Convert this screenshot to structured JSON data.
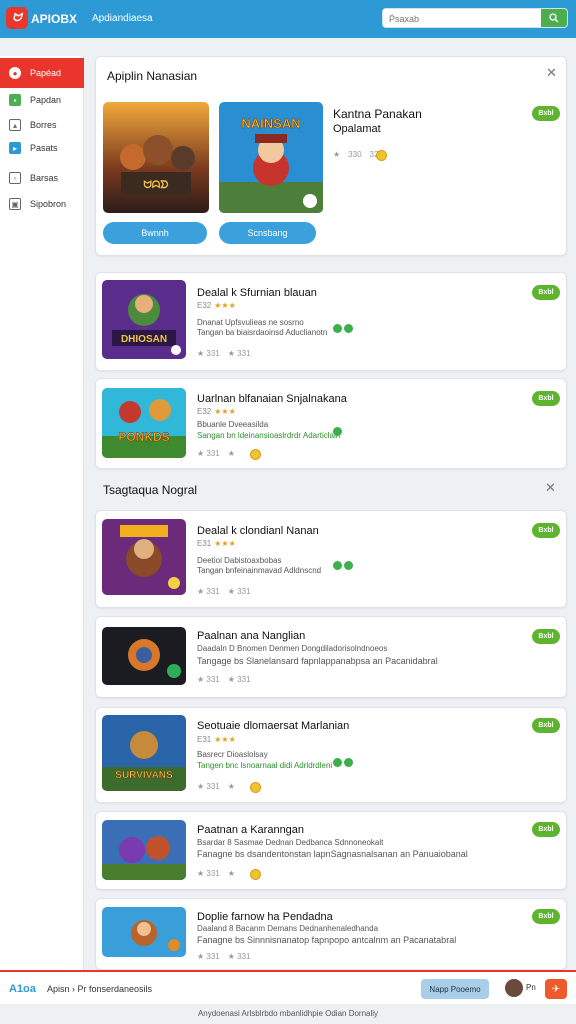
{
  "header": {
    "logo_text": "ᗢ",
    "brand": "APIOBX",
    "subtitle": "Apdiandiaesa",
    "search_placeholder": "Ṕsaxab"
  },
  "sidebar": {
    "items": [
      {
        "label": "Papéad",
        "icon": "game-icon",
        "active": true
      },
      {
        "label": "Papdan",
        "icon": "trend-icon"
      },
      {
        "label": "Borres",
        "icon": "chart-icon"
      },
      {
        "label": "Pasats",
        "icon": "share-icon"
      },
      {
        "label": "Barsas",
        "icon": "box-icon"
      },
      {
        "label": "Sipobron",
        "icon": "settings-icon"
      }
    ]
  },
  "featured": {
    "title": "Apiplin Nanasian",
    "game_title_line1": "Kantna Panakan",
    "game_title_line2": "Opalamat",
    "badge": "Bxbl",
    "rating": "330",
    "downloads": "320",
    "button1": "Bwnnh",
    "button2": "Scnsbang",
    "thumb2_text": "NAINSAN"
  },
  "list1": [
    {
      "title": "Dealal k Sfurnian blauan",
      "rating": "E32",
      "meta1": "Dnanat   Upfsvulieas ne sosrno",
      "meta2": "Tangan ba biaisrdaoinsd Aduclianotn",
      "count1": "331",
      "count2": "331",
      "badge": "Bxbl",
      "thumb_text": "DHIOSAN"
    },
    {
      "title": "Uarlnan blfanaian Snjalnakana",
      "rating": "E32",
      "meta1": "Bbuanle   Dveeasilda",
      "meta2": "Sangan bn ldeinansioaslrdrdr Adarticlaln",
      "count1": "331",
      "count2": "",
      "badge": "Bxbl",
      "thumb_text": "PONKDS"
    }
  ],
  "section2": {
    "title": "Tsagtaqua Nogral"
  },
  "list2": [
    {
      "title": "Dealal k clondianl Nanan",
      "rating": "E31",
      "meta1": "Deetioi   Dabistoaxbobas",
      "meta2": "Tangan bnfeinainmavad Adldnscnd",
      "count1": "331",
      "count2": "331",
      "badge": "Bxbl"
    },
    {
      "title": "Paalnan ana Nanglian",
      "rating": "",
      "meta1": "Daadaln D Bnomen Denmen Dongdiladorisolndnoeos",
      "meta2": "Tangage bs Slanelansard fapnlappanabpsa an Pacanidabral",
      "count1": "331",
      "count2": "331",
      "badge": "Bxbl"
    },
    {
      "title": "Seotuaie dlomaersat Marlanian",
      "rating": "E31",
      "meta1": "Basrecr   Dioaslolsay",
      "meta2": "Tangen bnc lsnoarnaal didi Adrldrdleni",
      "count1": "331",
      "count2": "",
      "badge": "Bxbl",
      "thumb_text": "SURVIVANS"
    },
    {
      "title": "Paatnan a Karanngan",
      "rating": "",
      "meta1": "Bsardar 8 Sasmae Dednan Dedbanca Sdnnoneokalt",
      "meta2": "Fanagne bs dsandentonstan lapnSagnasnalsanan an Panuaiobanal",
      "count1": "331",
      "count2": "",
      "badge": "Bxbl"
    },
    {
      "title": "Doplie farnow ha Pendadna",
      "rating": "",
      "meta1": "Daaland 8 Bacanm Demans Dednanhenaledhanda",
      "meta2": "Fanagne bs Sinnnisnanatop fapnpopo antcalnm an Pacanatabral",
      "count1": "331",
      "count2": "331",
      "badge": "Bxbl"
    }
  ],
  "bottombar": {
    "logo": "A1oa",
    "text": "Apisn  ›  Pr fonserdaneosils",
    "button": "Napp Pooemo",
    "count": "Pn",
    "red_icon": "✈"
  },
  "footer": {
    "text": "Anydoenasi Arlsblrbdo mbanlidhpie Odian Dornaliy"
  }
}
